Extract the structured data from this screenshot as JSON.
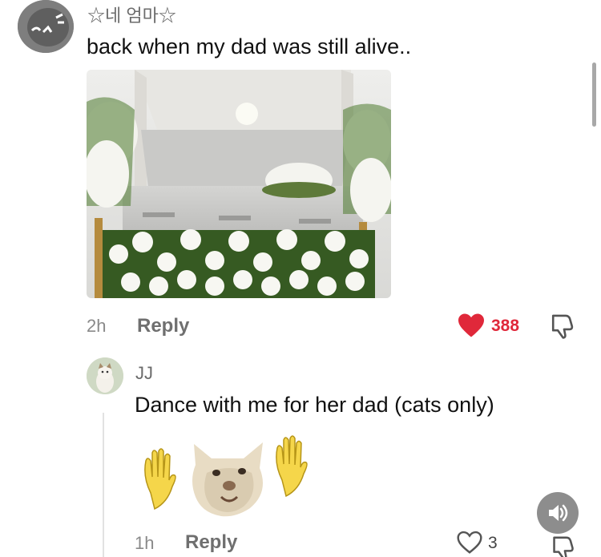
{
  "comment1": {
    "username": "☆네 엄마☆",
    "text": "back when my dad was still alive..",
    "time": "2h",
    "reply_label": "Reply",
    "likes": "388",
    "liked": true
  },
  "comment2": {
    "username": "JJ",
    "text": "Dance with me for her dad (cats only)",
    "time": "1h",
    "reply_label": "Reply",
    "likes": "3",
    "liked": false
  },
  "icons": {
    "heart_filled": "heart-filled-icon",
    "heart_outline": "heart-outline-icon",
    "dislike": "thumbs-down-icon",
    "sound": "speaker-icon"
  },
  "colors": {
    "like_red": "#e0283a",
    "text_gray": "#8a8a8a",
    "sound_button": "#8d8d8d"
  }
}
